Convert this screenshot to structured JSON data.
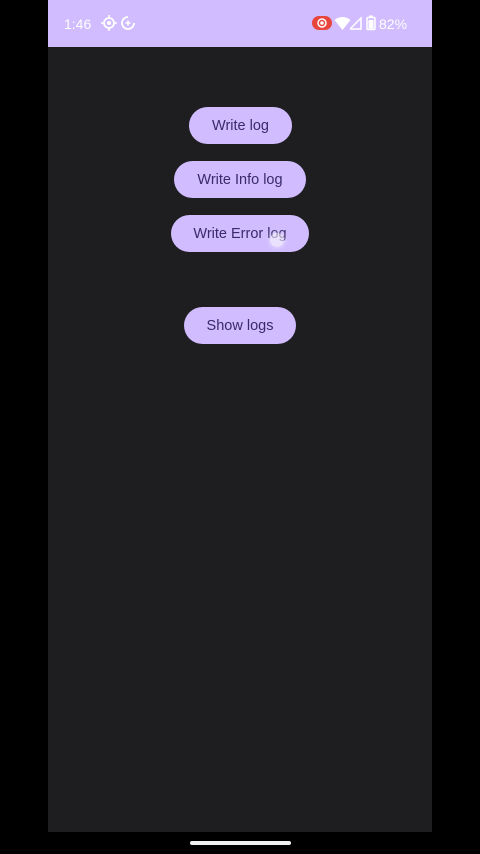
{
  "status_bar": {
    "time": "1:46",
    "battery": "82%",
    "icons": [
      "location-tracker-icon",
      "data-saver-icon",
      "screen-record-icon",
      "wifi-icon",
      "cell-signal-icon",
      "battery-icon"
    ]
  },
  "buttons": {
    "write_log": "Write log",
    "write_info_log": "Write Info log",
    "write_error_log": "Write Error log",
    "show_logs": "Show logs"
  },
  "colors": {
    "status_bar": "#d0bcff",
    "background": "#1e1e20",
    "button_bg": "#d0bcff",
    "button_text": "#3a2a6a",
    "record_indicator": "#e8453c"
  }
}
